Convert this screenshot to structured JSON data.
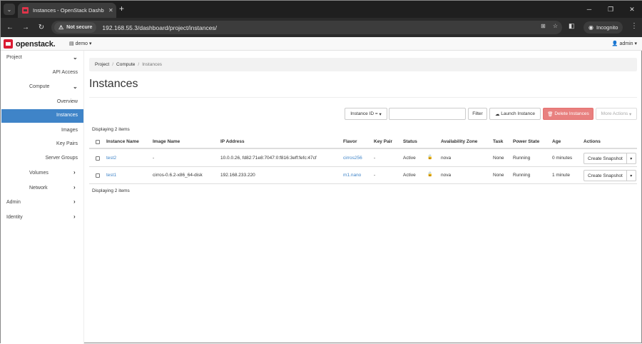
{
  "browser": {
    "tab_title": "Instances - OpenStack Dashboard",
    "tab_close": "✕",
    "new_tab": "+",
    "not_secure": "Not secure",
    "url": "192.168.55.3/dashboard/project/instances/",
    "incognito": "Incognito"
  },
  "navbar": {
    "logo": "openstack.",
    "project": "demo",
    "user": "admin"
  },
  "sidebar": {
    "project": "Project",
    "api_access": "API Access",
    "compute": "Compute",
    "overview": "Overview",
    "instances": "Instances",
    "images": "Images",
    "key_pairs": "Key Pairs",
    "server_groups": "Server Groups",
    "volumes": "Volumes",
    "network": "Network",
    "admin": "Admin",
    "identity": "Identity"
  },
  "breadcrumb": [
    "Project",
    "Compute",
    "Instances"
  ],
  "page_title": "Instances",
  "actions": {
    "filter_field": "Instance ID =",
    "filter": "Filter",
    "launch": "Launch Instance",
    "delete": "Delete Instances",
    "more": "More Actions"
  },
  "displaying": "Displaying 2 items",
  "table": {
    "headers": [
      "Instance Name",
      "Image Name",
      "IP Address",
      "Flavor",
      "Key Pair",
      "Status",
      "Availability Zone",
      "Task",
      "Power State",
      "Age",
      "Actions"
    ],
    "rows": [
      {
        "name": "test2",
        "image": "-",
        "ip": "10.0.0.26, fd82:71e8:7047:0:f816:3eff:fefc:47cf",
        "flavor": "cirros256",
        "key_pair": "-",
        "status": "Active",
        "zone": "nova",
        "task": "None",
        "power": "Running",
        "age": "0 minutes",
        "action": "Create Snapshot"
      },
      {
        "name": "test1",
        "image": "cirros-0.6.2-x86_64-disk",
        "ip": "192.168.233.220",
        "flavor": "m1.nano",
        "key_pair": "-",
        "status": "Active",
        "zone": "nova",
        "task": "None",
        "power": "Running",
        "age": "1 minute",
        "action": "Create Snapshot"
      }
    ]
  }
}
